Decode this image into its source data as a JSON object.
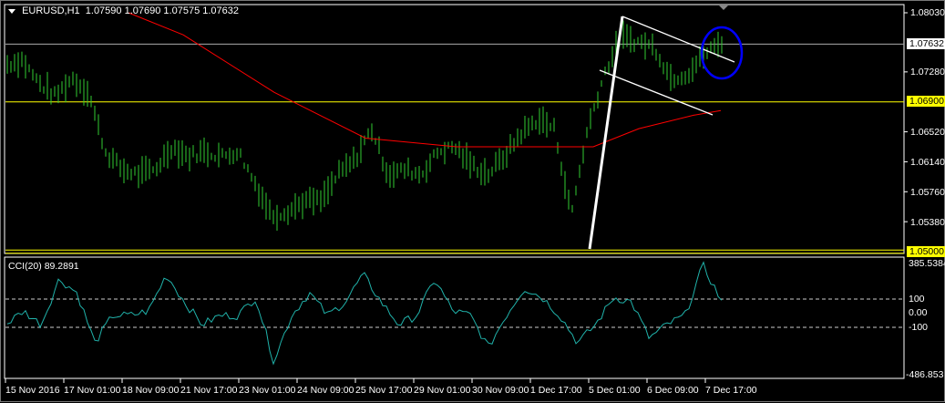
{
  "header": {
    "symbol": "EURUSD,H1",
    "open": "1.07590",
    "high": "1.07690",
    "low": "1.07575",
    "close": "1.07632"
  },
  "price_axis": {
    "ticks": [
      "1.08030",
      "1.07280",
      "1.06520",
      "1.06140",
      "1.05760",
      "1.05380"
    ],
    "current": "1.07632",
    "level_1": "1.06900",
    "level_2": "1.05000"
  },
  "cci": {
    "title": "CCI(20)",
    "value": "89.2891",
    "max": "385.5384",
    "min": "-486.853",
    "levels": [
      "100",
      "0.00",
      "-100"
    ]
  },
  "time_axis": [
    "15 Nov 2016",
    "17 Nov 01:00",
    "18 Nov 09:00",
    "21 Nov 17:00",
    "23 Nov 01:00",
    "24 Nov 09:00",
    "25 Nov 17:00",
    "29 Nov 01:00",
    "30 Nov 09:00",
    "1 Dec 17:00",
    "5 Dec 01:00",
    "6 Dec 09:00",
    "7 Dec 17:00"
  ],
  "colors": {
    "bars": "#32cd32",
    "ma": "#ff0000",
    "cci": "#20b2aa",
    "level": "#ffff00",
    "ellipse": "#0000ff"
  },
  "chart_data": {
    "type": "line",
    "price_range": [
      1.05,
      1.0815
    ],
    "price_path": [
      1.0737,
      1.0743,
      1.0714,
      1.0697,
      1.072,
      1.0702,
      1.0627,
      1.0604,
      1.0598,
      1.0604,
      1.0633,
      1.0621,
      1.0627,
      1.0621,
      1.0627,
      1.0587,
      1.0546,
      1.0552,
      1.0564,
      1.0564,
      1.0598,
      1.0616,
      1.0656,
      1.0598,
      1.0604,
      1.0598,
      1.0627,
      1.0633,
      1.061,
      1.0598,
      1.0621,
      1.065,
      1.0668,
      1.0656,
      1.0546,
      1.0656,
      1.0726,
      1.0772,
      1.0766,
      1.076,
      1.072,
      1.0726,
      1.0749,
      1.0766
    ],
    "ma_path": [
      1.0803,
      1.0775,
      1.0702,
      1.0644,
      1.0633,
      1.0633,
      1.0633,
      1.0656,
      1.0673,
      1.0679
    ],
    "cci_range": [
      -486.853,
      385.5384
    ],
    "cci_path": [
      -81,
      16,
      -81,
      242,
      145,
      -210,
      -16,
      -16,
      16,
      274,
      81,
      -81,
      -16,
      -16,
      113,
      -339,
      -16,
      145,
      -16,
      81,
      274,
      81,
      -81,
      -16,
      242,
      16,
      -16,
      -242,
      -16,
      177,
      113,
      -16,
      -210,
      -81,
      113,
      81,
      -177,
      -81,
      -16,
      339,
      94
    ]
  }
}
